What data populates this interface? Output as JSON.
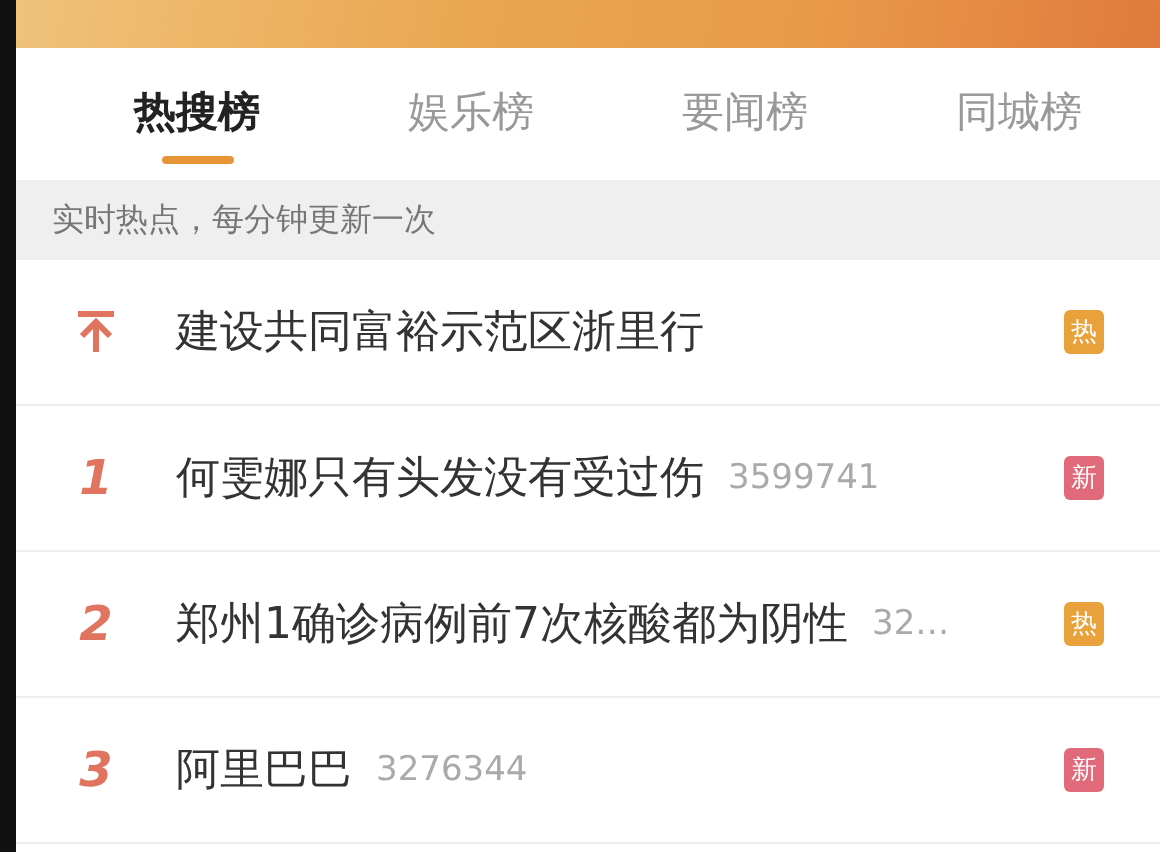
{
  "tabs": [
    {
      "label": "热搜榜",
      "selected": true
    },
    {
      "label": "娱乐榜",
      "selected": false
    },
    {
      "label": "要闻榜",
      "selected": false
    },
    {
      "label": "同城榜",
      "selected": false
    }
  ],
  "notice": "实时热点，每分钟更新一次",
  "items": [
    {
      "kind": "pinned",
      "title": "建设共同富裕示范区浙里行",
      "badge": {
        "label": "热",
        "color": "#e9a23b"
      }
    },
    {
      "kind": "ranked",
      "rank": "1",
      "title": "何雯娜只有头发没有受过伤",
      "count": "3599741",
      "badge": {
        "label": "新",
        "color": "#e06a7a"
      }
    },
    {
      "kind": "ranked",
      "rank": "2",
      "title": "郑州1确诊病例前7次核酸都为阴性",
      "count": "32…",
      "badge": {
        "label": "热",
        "color": "#e9a23b"
      }
    },
    {
      "kind": "ranked",
      "rank": "3",
      "title": "阿里巴巴",
      "count": "3276344",
      "badge": {
        "label": "新",
        "color": "#e06a7a"
      }
    }
  ]
}
